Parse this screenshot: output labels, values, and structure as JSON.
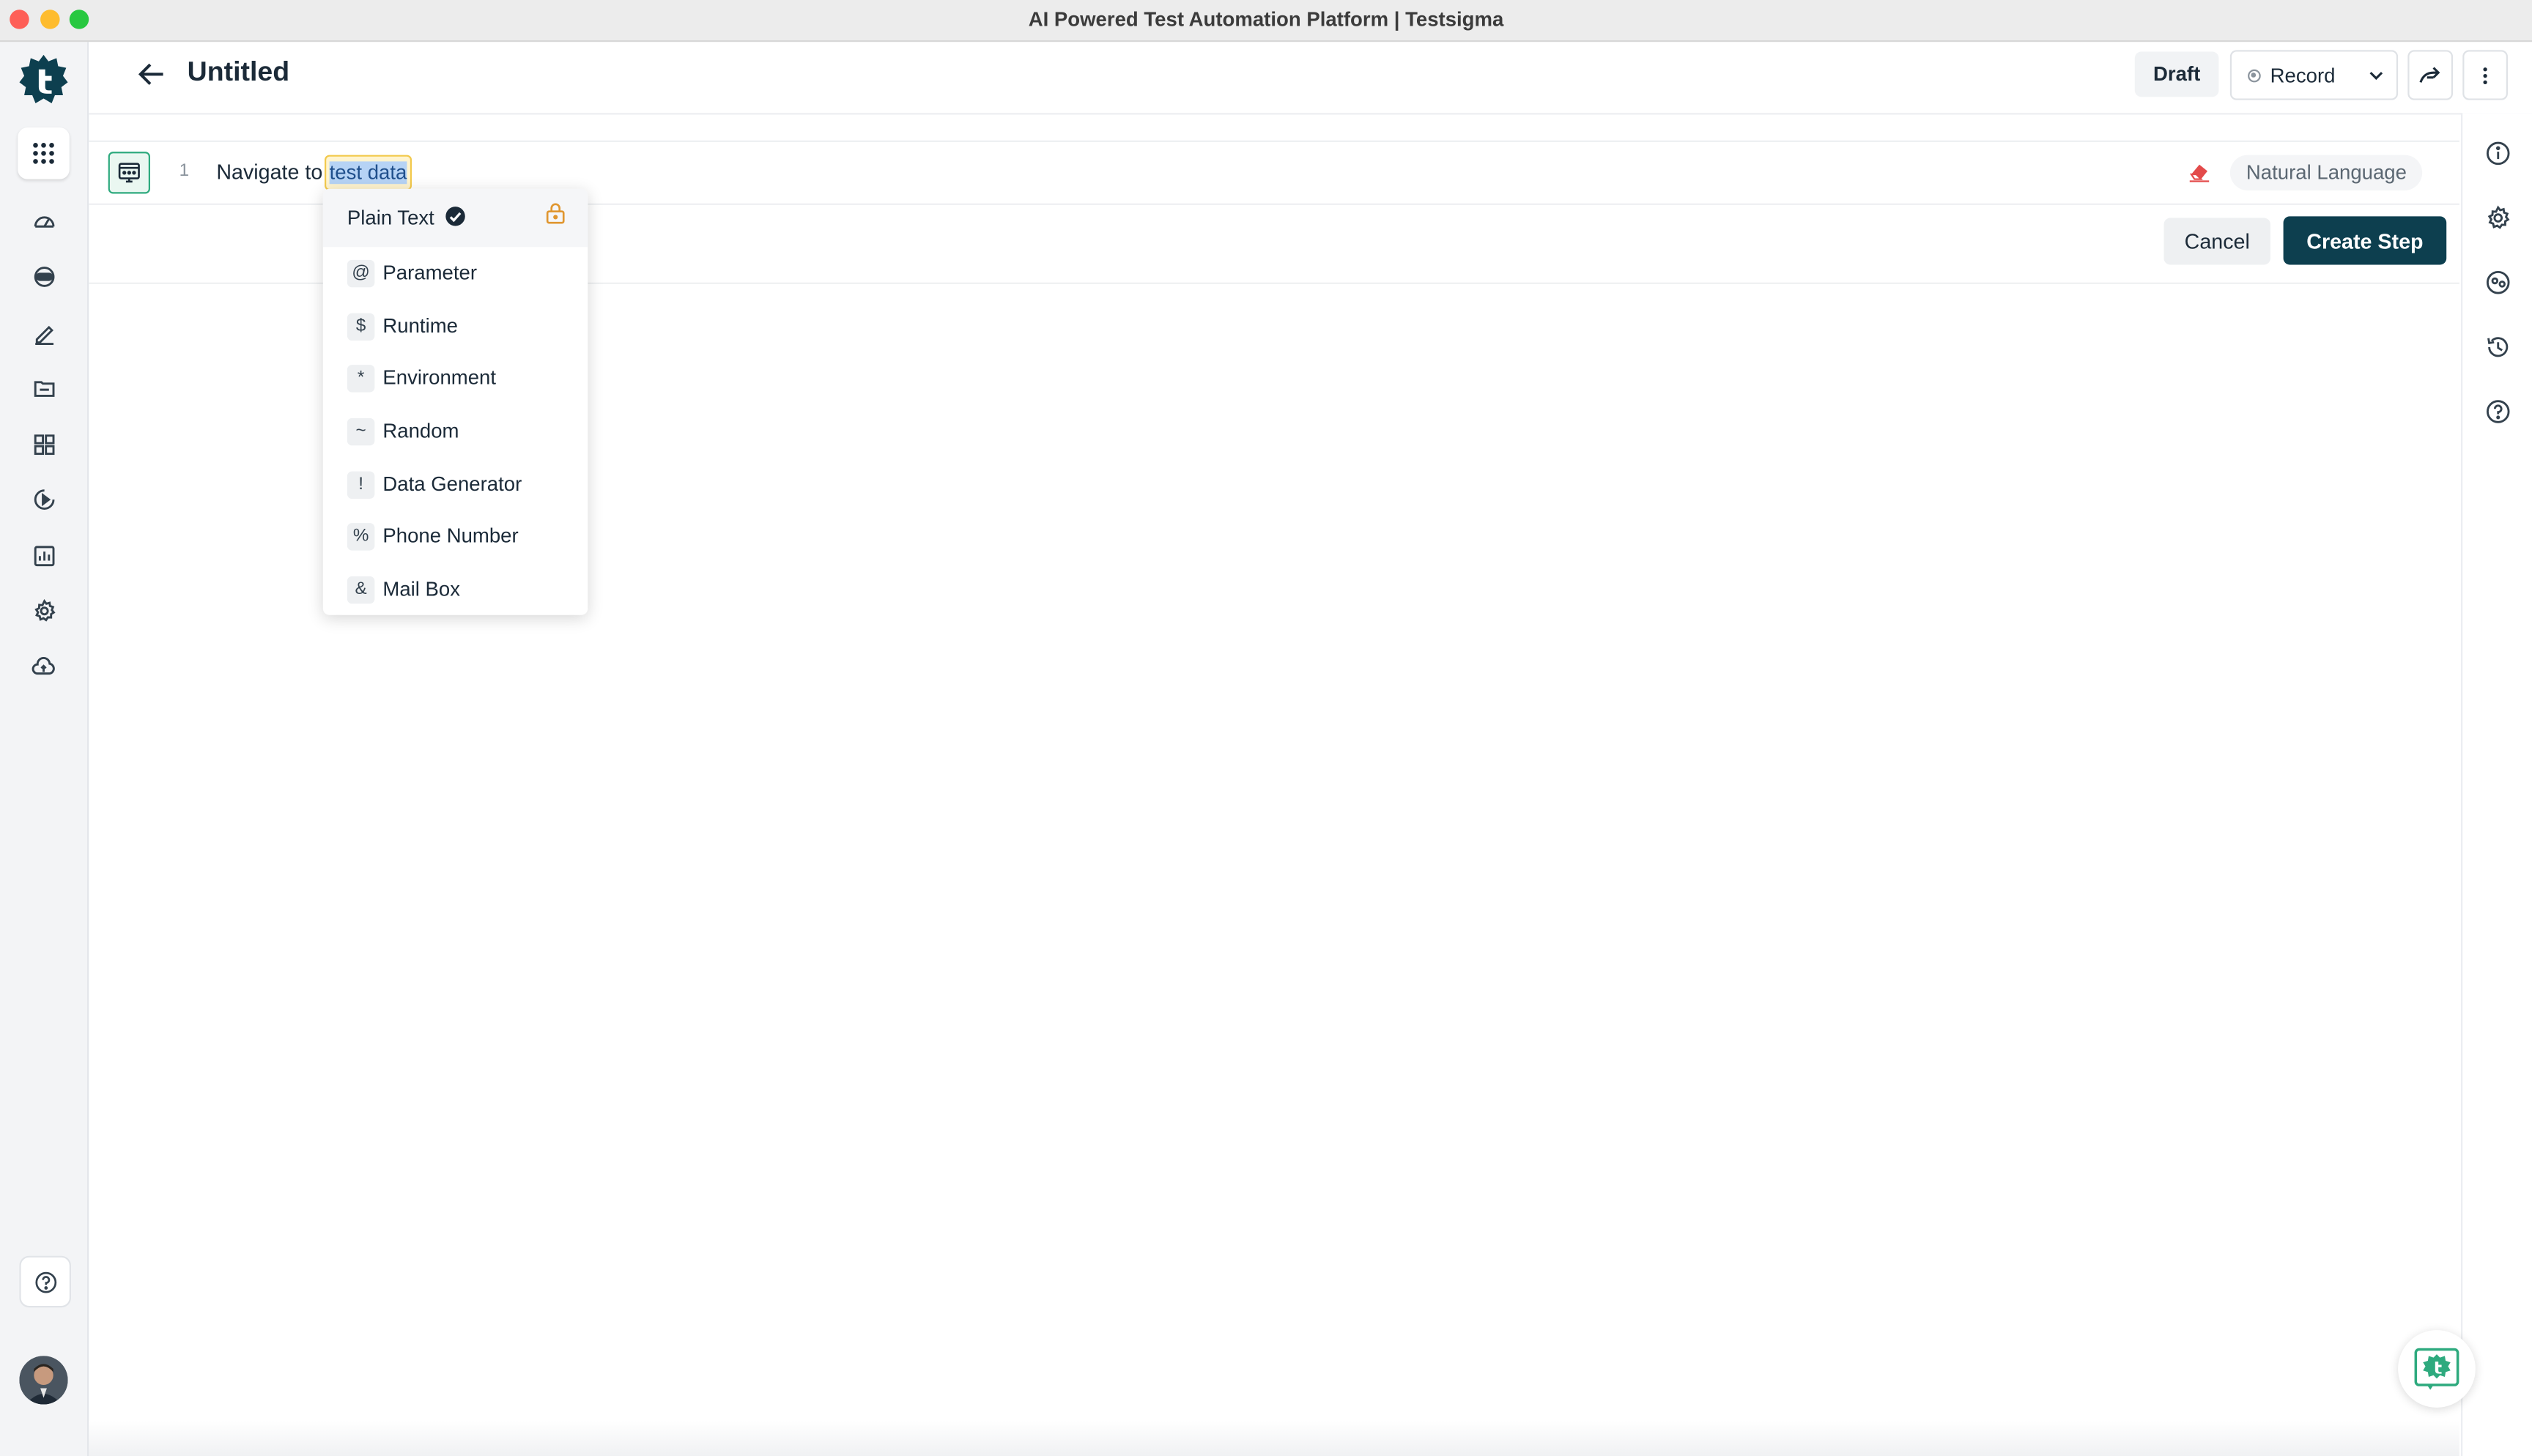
{
  "window": {
    "title": "AI Powered Test Automation Platform | Testsigma"
  },
  "header": {
    "page_title": "Untitled",
    "draft_label": "Draft",
    "record_label": "Record"
  },
  "step": {
    "number": "1",
    "action_text": "Navigate to",
    "test_data_value": "test data",
    "mode_label": "Natural Language"
  },
  "actions": {
    "cancel_label": "Cancel",
    "create_label": "Create Step"
  },
  "data_type_menu": {
    "selected": "Plain Text",
    "items": [
      {
        "symbol": "@",
        "label": "Parameter"
      },
      {
        "symbol": "$",
        "label": "Runtime"
      },
      {
        "symbol": "*",
        "label": "Environment"
      },
      {
        "symbol": "~",
        "label": "Random"
      },
      {
        "symbol": "!",
        "label": "Data Generator"
      },
      {
        "symbol": "%",
        "label": "Phone Number"
      },
      {
        "symbol": "&",
        "label": "Mail Box"
      }
    ]
  },
  "sidebar": {
    "items": [
      "apps-grid-icon",
      "dashboard-icon",
      "agent-icon",
      "edit-icon",
      "folder-icon",
      "modules-icon",
      "run-icon",
      "reports-icon",
      "settings-icon",
      "cloud-icon"
    ]
  },
  "colors": {
    "brand": "#0d3f4f",
    "accent_green": "#2eaa7e",
    "highlight": "#fff4cf"
  }
}
